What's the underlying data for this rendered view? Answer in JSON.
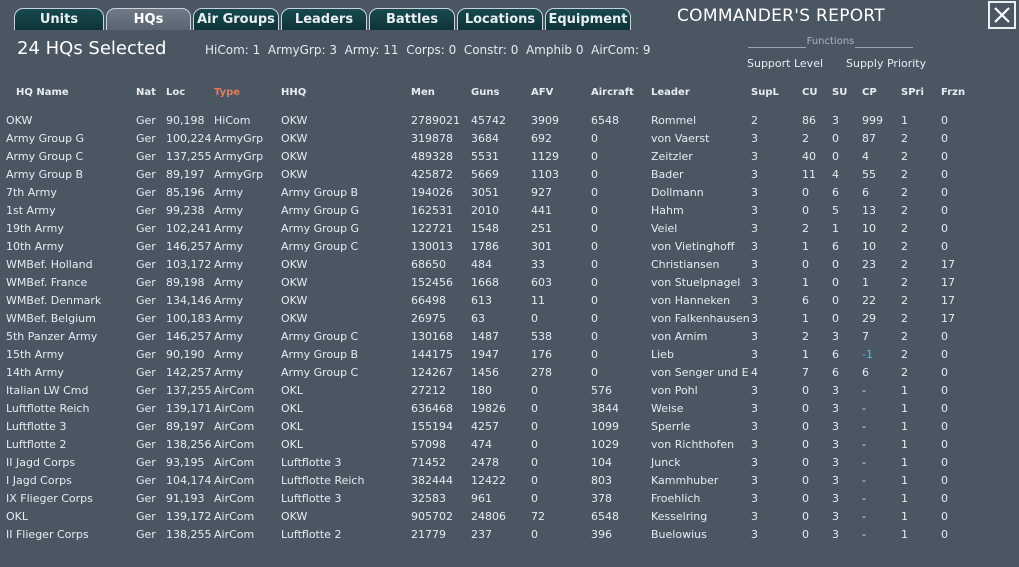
{
  "tabs": [
    {
      "label": "Units",
      "active": false
    },
    {
      "label": "HQs",
      "active": true
    },
    {
      "label": "Air Groups",
      "active": false
    },
    {
      "label": "Leaders",
      "active": false
    },
    {
      "label": "Battles",
      "active": false
    },
    {
      "label": "Locations",
      "active": false
    },
    {
      "label": "Equipment",
      "active": false
    }
  ],
  "header": {
    "title": "COMMANDER'S REPORT",
    "selected_count": "24 HQs Selected",
    "summary": "HiCom: 1  ArmyGrp: 3  Army: 11  Corps: 0  Constr: 0  Amphib 0  AirCom: 9"
  },
  "functions": {
    "title": "Functions",
    "support_level": "Support Level",
    "supply_priority": "Supply Priority"
  },
  "colors": {
    "sorted_header": "#e07a5f",
    "negative_value": "#3ec7e6",
    "background": "#4b5663"
  },
  "table": {
    "columns": [
      "HQ Name",
      "Nat",
      "Loc",
      "Type",
      "HHQ",
      "Men",
      "Guns",
      "AFV",
      "Aircraft",
      "Leader",
      "SupL",
      "CU",
      "SU",
      "CP",
      "SPri",
      "Frzn"
    ],
    "sorted_column": "Type",
    "rows": [
      [
        "OKW",
        "Ger",
        "90,198",
        "HiCom",
        "OKW",
        "2789021",
        "45742",
        "3909",
        "6548",
        "Rommel",
        "2",
        "86",
        "3",
        "999",
        "1",
        "0"
      ],
      [
        "Army Group G",
        "Ger",
        "100,224",
        "ArmyGrp",
        "OKW",
        "319878",
        "3684",
        "692",
        "0",
        "von Vaerst",
        "3",
        "2",
        "0",
        "87",
        "2",
        "0"
      ],
      [
        "Army Group C",
        "Ger",
        "137,255",
        "ArmyGrp",
        "OKW",
        "489328",
        "5531",
        "1129",
        "0",
        "Zeitzler",
        "3",
        "40",
        "0",
        "4",
        "2",
        "0"
      ],
      [
        "Army Group B",
        "Ger",
        "89,197",
        "ArmyGrp",
        "OKW",
        "425872",
        "5669",
        "1103",
        "0",
        "Bader",
        "3",
        "11",
        "4",
        "55",
        "2",
        "0"
      ],
      [
        "7th Army",
        "Ger",
        "85,196",
        "Army",
        "Army Group B",
        "194026",
        "3051",
        "927",
        "0",
        "Dollmann",
        "3",
        "0",
        "6",
        "6",
        "2",
        "0"
      ],
      [
        "1st Army",
        "Ger",
        "99,238",
        "Army",
        "Army Group G",
        "162531",
        "2010",
        "441",
        "0",
        "Hahm",
        "3",
        "0",
        "5",
        "13",
        "2",
        "0"
      ],
      [
        "19th Army",
        "Ger",
        "102,241",
        "Army",
        "Army Group G",
        "122721",
        "1548",
        "251",
        "0",
        "Veiel",
        "3",
        "2",
        "1",
        "10",
        "2",
        "0"
      ],
      [
        "10th Army",
        "Ger",
        "146,257",
        "Army",
        "Army Group C",
        "130013",
        "1786",
        "301",
        "0",
        "von Vietinghoff",
        "3",
        "1",
        "6",
        "10",
        "2",
        "0"
      ],
      [
        "WMBef. Holland",
        "Ger",
        "103,172",
        "Army",
        "OKW",
        "68650",
        "484",
        "33",
        "0",
        "Christiansen",
        "3",
        "0",
        "0",
        "23",
        "2",
        "17"
      ],
      [
        "WMBef. France",
        "Ger",
        "89,198",
        "Army",
        "OKW",
        "152456",
        "1668",
        "603",
        "0",
        "von Stuelpnagel",
        "3",
        "1",
        "0",
        "1",
        "2",
        "17"
      ],
      [
        "WMBef. Denmark",
        "Ger",
        "134,146",
        "Army",
        "OKW",
        "66498",
        "613",
        "11",
        "0",
        "von Hanneken",
        "3",
        "6",
        "0",
        "22",
        "2",
        "17"
      ],
      [
        "WMBef. Belgium",
        "Ger",
        "100,183",
        "Army",
        "OKW",
        "26975",
        "63",
        "0",
        "0",
        "von Falkenhausen",
        "3",
        "1",
        "0",
        "29",
        "2",
        "17"
      ],
      [
        "5th Panzer Army",
        "Ger",
        "146,257",
        "Army",
        "Army Group C",
        "130168",
        "1487",
        "538",
        "0",
        "von Arnim",
        "3",
        "2",
        "3",
        "7",
        "2",
        "0"
      ],
      [
        "15th Army",
        "Ger",
        "90,190",
        "Army",
        "Army Group B",
        "144175",
        "1947",
        "176",
        "0",
        "Lieb",
        "3",
        "1",
        "6",
        "-1",
        "2",
        "0"
      ],
      [
        "14th Army",
        "Ger",
        "142,257",
        "Army",
        "Army Group C",
        "124267",
        "1456",
        "278",
        "0",
        "von Senger und E",
        "4",
        "7",
        "6",
        "6",
        "2",
        "0"
      ],
      [
        "Italian LW Cmd",
        "Ger",
        "137,255",
        "AirCom",
        "OKL",
        "27212",
        "180",
        "0",
        "576",
        "von Pohl",
        "3",
        "0",
        "3",
        "-",
        "1",
        "0"
      ],
      [
        "Luftflotte Reich",
        "Ger",
        "139,171",
        "AirCom",
        "OKL",
        "636468",
        "19826",
        "0",
        "3844",
        "Weise",
        "3",
        "0",
        "3",
        "-",
        "1",
        "0"
      ],
      [
        "Luftflotte 3",
        "Ger",
        "89,197",
        "AirCom",
        "OKL",
        "155194",
        "4257",
        "0",
        "1099",
        "Sperrle",
        "3",
        "0",
        "3",
        "-",
        "1",
        "0"
      ],
      [
        "Luftflotte 2",
        "Ger",
        "138,256",
        "AirCom",
        "OKL",
        "57098",
        "474",
        "0",
        "1029",
        "von Richthofen",
        "3",
        "0",
        "3",
        "-",
        "1",
        "0"
      ],
      [
        "II Jagd Corps",
        "Ger",
        "93,195",
        "AirCom",
        "Luftflotte 3",
        "71452",
        "2478",
        "0",
        "104",
        "Junck",
        "3",
        "0",
        "3",
        "-",
        "1",
        "0"
      ],
      [
        "I Jagd Corps",
        "Ger",
        "104,174",
        "AirCom",
        "Luftflotte Reich",
        "382444",
        "12422",
        "0",
        "803",
        "Kammhuber",
        "3",
        "0",
        "3",
        "-",
        "1",
        "0"
      ],
      [
        "IX Flieger Corps",
        "Ger",
        "91,193",
        "AirCom",
        "Luftflotte 3",
        "32583",
        "961",
        "0",
        "378",
        "Froehlich",
        "3",
        "0",
        "3",
        "-",
        "1",
        "0"
      ],
      [
        "OKL",
        "Ger",
        "139,172",
        "AirCom",
        "OKW",
        "905702",
        "24806",
        "72",
        "6548",
        "Kesselring",
        "3",
        "0",
        "3",
        "-",
        "1",
        "0"
      ],
      [
        "II Flieger Corps",
        "Ger",
        "138,255",
        "AirCom",
        "Luftflotte 2",
        "21779",
        "237",
        "0",
        "396",
        "Buelowius",
        "3",
        "0",
        "3",
        "-",
        "1",
        "0"
      ]
    ]
  }
}
